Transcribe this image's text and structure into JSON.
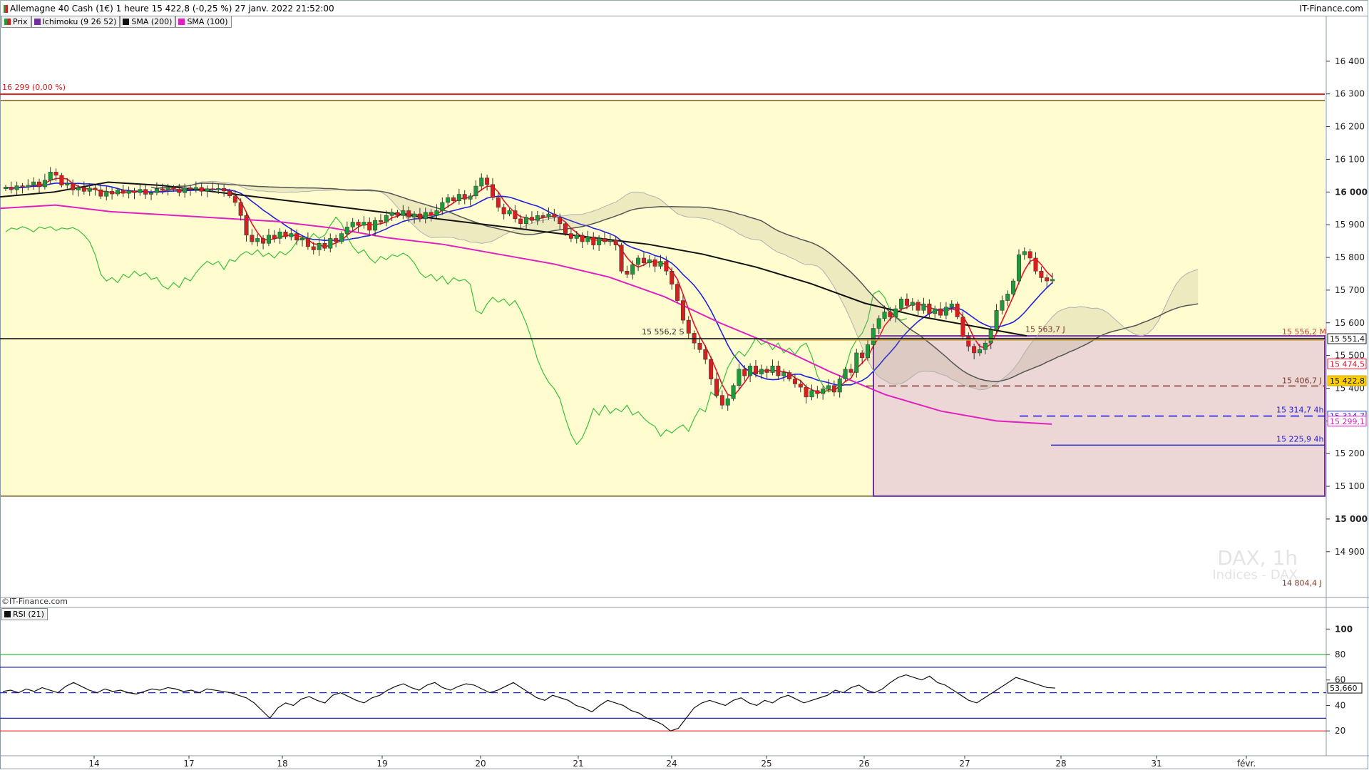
{
  "header": {
    "instrument": "Allemagne 40 Cash (1€) 1 heure 15 422,8 (-0,25 %) 27 janv. 2022 21:52:00",
    "brand": "IT-Finance.com"
  },
  "legend": {
    "price": "Prix",
    "ichimoku": "Ichimoku (9 26 52)",
    "sma200": "SMA (200)",
    "sma100": "SMA (100)"
  },
  "footer": {
    "copyright": "©IT-Finance.com",
    "rsi_label": "RSI (21)"
  },
  "watermark": {
    "line1": "DAX, 1h",
    "line2": "Indices - DAX"
  },
  "colors": {
    "candle_up": "#1f9a3a",
    "candle_down": "#d42020",
    "sma200": "#111111",
    "sma100": "#e020c0",
    "tenkan": "#e8102a",
    "kijun": "#2020e0",
    "chikou": "#38c038",
    "zone_yellow": "#fffdd0",
    "zone_pink": "#ecd6d6",
    "resistance": "#d42020"
  },
  "chart_data": [
    {
      "type": "candlestick",
      "title": "Allemagne 40 Cash (1€) 1 heure",
      "x_ticks": [
        "14",
        "17",
        "18",
        "19",
        "20",
        "21",
        "24",
        "25",
        "26",
        "27",
        "28",
        "31",
        "févr."
      ],
      "y_ticks": [
        14900,
        15000,
        15100,
        15200,
        15300,
        15400,
        15500,
        15600,
        15700,
        15800,
        15900,
        16000,
        16100,
        16200,
        16300,
        16400
      ],
      "y_tick_labels": [
        "14 900",
        "15 000",
        "15 100",
        "15 200",
        "15 300",
        "15 400",
        "15 500",
        "15 600",
        "15 700",
        "15 800",
        "15 900",
        "16 000",
        "16 100",
        "16 200",
        "16 300",
        "16 400"
      ],
      "ylim": [
        14760,
        16500
      ],
      "levels": [
        {
          "value": 16299,
          "label": "16 299 (0,00 %)"
        },
        {
          "value": 15551.4,
          "label": "15 551,4"
        },
        {
          "value": 15563.7,
          "label": "15 563,7 J"
        },
        {
          "value": 15556.2,
          "label": "15 556,2 S"
        },
        {
          "value": 15556.2,
          "label": "15 556,2 M"
        },
        {
          "value": 15406.7,
          "label": "15 406,7 J"
        },
        {
          "value": 15314.7,
          "label": "15 314,7 4h"
        },
        {
          "value": 15225.9,
          "label": "15 225,9 4h"
        },
        {
          "value": 14804.4,
          "label": "14 804,4 J"
        }
      ],
      "price_tags": [
        {
          "value": 15551.4,
          "label": "15 551,4"
        },
        {
          "value": 15474.5,
          "label": "15 474,5"
        },
        {
          "value": 15422.8,
          "label": "15 422,8"
        },
        {
          "value": 15314.7,
          "label": "15 314,7"
        },
        {
          "value": 15299.1,
          "label": "15 299,1"
        }
      ],
      "zones": [
        {
          "from": 15070,
          "to": 16280,
          "color": "yellow"
        },
        {
          "from": 15070,
          "to": 15560,
          "color": "pink",
          "x_from": "26",
          "x_to": "end"
        }
      ],
      "series": [
        {
          "name": "SMA (200)",
          "values": [
            15985,
            16000,
            16030,
            16020,
            16000,
            15980,
            15960,
            15940,
            15920,
            15900,
            15880,
            15860,
            15840,
            15810,
            15770,
            15720,
            15660,
            15620,
            15590,
            15560
          ]
        },
        {
          "name": "SMA (100)",
          "values": [
            15950,
            15960,
            15940,
            15930,
            15920,
            15910,
            15890,
            15860,
            15840,
            15810,
            15780,
            15740,
            15680,
            15600,
            15530,
            15450,
            15380,
            15330,
            15300,
            15290
          ]
        }
      ],
      "candles": {
        "start": 16010,
        "steps": [
          5,
          -8,
          12,
          -4,
          6,
          10,
          -15,
          20,
          25,
          -10,
          -30,
          5,
          -20,
          8,
          -12,
          10,
          -5,
          -20,
          15,
          -8,
          12,
          -10,
          8,
          -6,
          10,
          -15,
          5,
          12,
          -4,
          8,
          -6,
          -10,
          15,
          -5,
          6,
          -12,
          8,
          -3,
          4,
          -8,
          -15,
          -20,
          -40,
          -60,
          -20,
          10,
          -15,
          25,
          -10,
          20,
          -15,
          10,
          -20,
          5,
          -25,
          -10,
          20,
          -15,
          30,
          -10,
          25,
          20,
          15,
          -10,
          10,
          -25,
          30,
          -5,
          20,
          10,
          -10,
          15,
          -20,
          10,
          -15,
          20,
          -10,
          15,
          25,
          15,
          -10,
          20,
          -15,
          10,
          30,
          25,
          -20,
          -40,
          -30,
          -20,
          10,
          -25,
          -15,
          20,
          -10,
          15,
          -5,
          10,
          -10,
          -20,
          -30,
          -15,
          10,
          -20,
          15,
          -25,
          20,
          -10,
          5,
          -15,
          -80,
          -10,
          30,
          20,
          -15,
          10,
          -20,
          15,
          -30,
          -40,
          -50,
          -60,
          -40,
          -30,
          -20,
          -30,
          -60,
          -50,
          -30,
          20,
          40,
          50,
          -20,
          30,
          -25,
          15,
          -10,
          20,
          -30,
          10,
          -20,
          -15,
          -10,
          -30,
          20,
          -10,
          15,
          10,
          -20,
          40,
          30,
          -10,
          60,
          -15,
          40,
          50,
          30,
          20,
          -15,
          25,
          30,
          -20,
          10,
          -25,
          20,
          -30,
          15,
          -20,
          25,
          10,
          -40,
          -60,
          -30,
          -20,
          10,
          20,
          40,
          60,
          30,
          20,
          40,
          80,
          10,
          -20,
          -40,
          -20,
          -10,
          5
        ],
        "wick": 14
      }
    },
    {
      "type": "line",
      "title": "RSI (21)",
      "y_ticks": [
        20,
        40,
        60,
        80,
        100
      ],
      "ylim": [
        5,
        108
      ],
      "levels": [
        {
          "value": 70
        },
        {
          "value": 30
        },
        {
          "value": 80
        },
        {
          "value": 20
        },
        {
          "value": 50
        }
      ],
      "last_value": "53,660",
      "series": [
        {
          "name": "RSI (21)",
          "values": [
            51,
            52,
            50,
            53,
            51,
            54,
            52,
            50,
            55,
            58,
            55,
            52,
            50,
            53,
            51,
            52,
            50,
            49,
            51,
            53,
            52,
            54,
            53,
            51,
            52,
            50,
            53,
            52,
            51,
            50,
            48,
            46,
            42,
            36,
            30,
            38,
            42,
            40,
            45,
            47,
            44,
            42,
            48,
            50,
            47,
            44,
            42,
            46,
            48,
            52,
            55,
            57,
            54,
            52,
            56,
            58,
            54,
            52,
            55,
            57,
            56,
            53,
            50,
            52,
            55,
            58,
            54,
            50,
            46,
            44,
            48,
            46,
            44,
            40,
            38,
            35,
            40,
            44,
            42,
            40,
            36,
            34,
            30,
            28,
            25,
            20,
            22,
            30,
            38,
            42,
            44,
            42,
            40,
            44,
            46,
            42,
            40,
            44,
            42,
            46,
            48,
            45,
            42,
            44,
            46,
            48,
            52,
            50,
            54,
            56,
            52,
            50,
            53,
            58,
            62,
            64,
            62,
            60,
            63,
            58,
            56,
            52,
            48,
            44,
            42,
            46,
            50,
            54,
            58,
            62,
            60,
            58,
            56,
            54,
            53.66
          ]
        }
      ]
    }
  ]
}
